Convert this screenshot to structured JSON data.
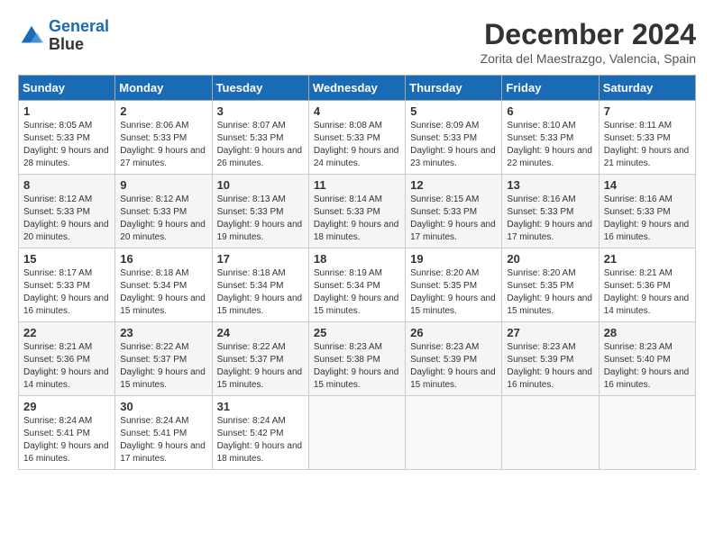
{
  "header": {
    "logo_line1": "General",
    "logo_line2": "Blue",
    "month": "December 2024",
    "location": "Zorita del Maestrazgo, Valencia, Spain"
  },
  "weekdays": [
    "Sunday",
    "Monday",
    "Tuesday",
    "Wednesday",
    "Thursday",
    "Friday",
    "Saturday"
  ],
  "weeks": [
    [
      {
        "day": "1",
        "sunrise": "8:05 AM",
        "sunset": "5:33 PM",
        "daylight": "9 hours and 28 minutes."
      },
      {
        "day": "2",
        "sunrise": "8:06 AM",
        "sunset": "5:33 PM",
        "daylight": "9 hours and 27 minutes."
      },
      {
        "day": "3",
        "sunrise": "8:07 AM",
        "sunset": "5:33 PM",
        "daylight": "9 hours and 26 minutes."
      },
      {
        "day": "4",
        "sunrise": "8:08 AM",
        "sunset": "5:33 PM",
        "daylight": "9 hours and 24 minutes."
      },
      {
        "day": "5",
        "sunrise": "8:09 AM",
        "sunset": "5:33 PM",
        "daylight": "9 hours and 23 minutes."
      },
      {
        "day": "6",
        "sunrise": "8:10 AM",
        "sunset": "5:33 PM",
        "daylight": "9 hours and 22 minutes."
      },
      {
        "day": "7",
        "sunrise": "8:11 AM",
        "sunset": "5:33 PM",
        "daylight": "9 hours and 21 minutes."
      }
    ],
    [
      {
        "day": "8",
        "sunrise": "8:12 AM",
        "sunset": "5:33 PM",
        "daylight": "9 hours and 20 minutes."
      },
      {
        "day": "9",
        "sunrise": "8:12 AM",
        "sunset": "5:33 PM",
        "daylight": "9 hours and 20 minutes."
      },
      {
        "day": "10",
        "sunrise": "8:13 AM",
        "sunset": "5:33 PM",
        "daylight": "9 hours and 19 minutes."
      },
      {
        "day": "11",
        "sunrise": "8:14 AM",
        "sunset": "5:33 PM",
        "daylight": "9 hours and 18 minutes."
      },
      {
        "day": "12",
        "sunrise": "8:15 AM",
        "sunset": "5:33 PM",
        "daylight": "9 hours and 17 minutes."
      },
      {
        "day": "13",
        "sunrise": "8:16 AM",
        "sunset": "5:33 PM",
        "daylight": "9 hours and 17 minutes."
      },
      {
        "day": "14",
        "sunrise": "8:16 AM",
        "sunset": "5:33 PM",
        "daylight": "9 hours and 16 minutes."
      }
    ],
    [
      {
        "day": "15",
        "sunrise": "8:17 AM",
        "sunset": "5:33 PM",
        "daylight": "9 hours and 16 minutes."
      },
      {
        "day": "16",
        "sunrise": "8:18 AM",
        "sunset": "5:34 PM",
        "daylight": "9 hours and 15 minutes."
      },
      {
        "day": "17",
        "sunrise": "8:18 AM",
        "sunset": "5:34 PM",
        "daylight": "9 hours and 15 minutes."
      },
      {
        "day": "18",
        "sunrise": "8:19 AM",
        "sunset": "5:34 PM",
        "daylight": "9 hours and 15 minutes."
      },
      {
        "day": "19",
        "sunrise": "8:20 AM",
        "sunset": "5:35 PM",
        "daylight": "9 hours and 15 minutes."
      },
      {
        "day": "20",
        "sunrise": "8:20 AM",
        "sunset": "5:35 PM",
        "daylight": "9 hours and 15 minutes."
      },
      {
        "day": "21",
        "sunrise": "8:21 AM",
        "sunset": "5:36 PM",
        "daylight": "9 hours and 14 minutes."
      }
    ],
    [
      {
        "day": "22",
        "sunrise": "8:21 AM",
        "sunset": "5:36 PM",
        "daylight": "9 hours and 14 minutes."
      },
      {
        "day": "23",
        "sunrise": "8:22 AM",
        "sunset": "5:37 PM",
        "daylight": "9 hours and 15 minutes."
      },
      {
        "day": "24",
        "sunrise": "8:22 AM",
        "sunset": "5:37 PM",
        "daylight": "9 hours and 15 minutes."
      },
      {
        "day": "25",
        "sunrise": "8:23 AM",
        "sunset": "5:38 PM",
        "daylight": "9 hours and 15 minutes."
      },
      {
        "day": "26",
        "sunrise": "8:23 AM",
        "sunset": "5:39 PM",
        "daylight": "9 hours and 15 minutes."
      },
      {
        "day": "27",
        "sunrise": "8:23 AM",
        "sunset": "5:39 PM",
        "daylight": "9 hours and 16 minutes."
      },
      {
        "day": "28",
        "sunrise": "8:23 AM",
        "sunset": "5:40 PM",
        "daylight": "9 hours and 16 minutes."
      }
    ],
    [
      {
        "day": "29",
        "sunrise": "8:24 AM",
        "sunset": "5:41 PM",
        "daylight": "9 hours and 16 minutes."
      },
      {
        "day": "30",
        "sunrise": "8:24 AM",
        "sunset": "5:41 PM",
        "daylight": "9 hours and 17 minutes."
      },
      {
        "day": "31",
        "sunrise": "8:24 AM",
        "sunset": "5:42 PM",
        "daylight": "9 hours and 18 minutes."
      },
      null,
      null,
      null,
      null
    ]
  ]
}
